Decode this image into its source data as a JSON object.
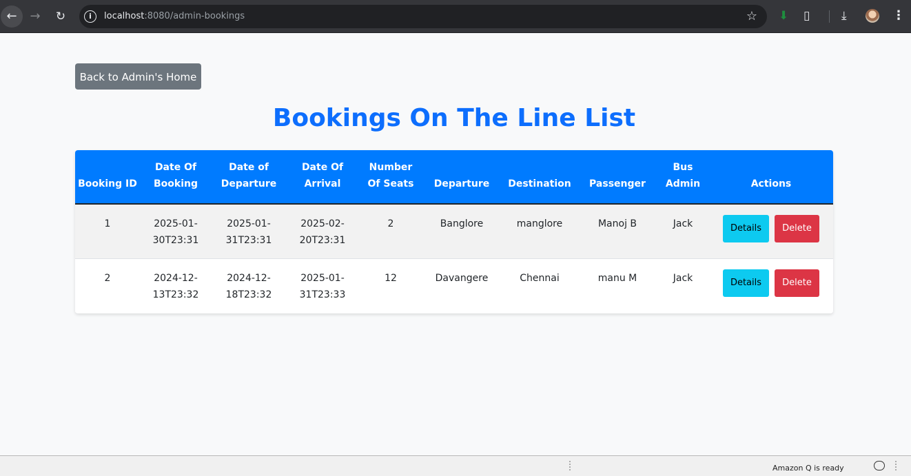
{
  "browser": {
    "url_host": "localhost",
    "url_rest": ":8080/admin-bookings",
    "icons": [
      "back-arrow-icon",
      "forward-arrow-icon",
      "reload-icon",
      "site-info-icon",
      "bookmark-star-icon",
      "extension-download-icon",
      "extensions-puzzle-icon",
      "downloads-icon",
      "profile-avatar",
      "menu-dots-icon"
    ]
  },
  "page": {
    "back_button_label": "Back to Admin's Home",
    "title": "Bookings On The Line List"
  },
  "table": {
    "headers": [
      "Booking ID",
      "Date Of Booking",
      "Date of Departure",
      "Date Of Arrival",
      "Number Of Seats",
      "Departure",
      "Destination",
      "Passenger",
      "Bus Admin",
      "Actions"
    ],
    "rows": [
      {
        "id": "1",
        "booking_date": "2025-01-30T23:31",
        "departure_date": "2025-01-31T23:31",
        "arrival_date": "2025-02-20T23:31",
        "seats": "2",
        "departure": "Banglore",
        "destination": "manglore",
        "passenger": "Manoj B",
        "bus_admin": "Jack",
        "details_label": "Details",
        "delete_label": "Delete"
      },
      {
        "id": "2",
        "booking_date": "2024-12-13T23:32",
        "departure_date": "2024-12-18T23:32",
        "arrival_date": "2025-01-31T23:33",
        "seats": "12",
        "departure": "Davangere",
        "destination": "Chennai",
        "passenger": "manu M",
        "bus_admin": "Jack",
        "details_label": "Details",
        "delete_label": "Delete"
      }
    ]
  },
  "status_bar": {
    "text": "Amazon Q is ready"
  },
  "colors": {
    "title_blue": "#0d6efd",
    "header_blue": "#007bff",
    "details_cyan": "#0dcaf0",
    "delete_red": "#dc3545",
    "back_gray": "#6c757d"
  }
}
